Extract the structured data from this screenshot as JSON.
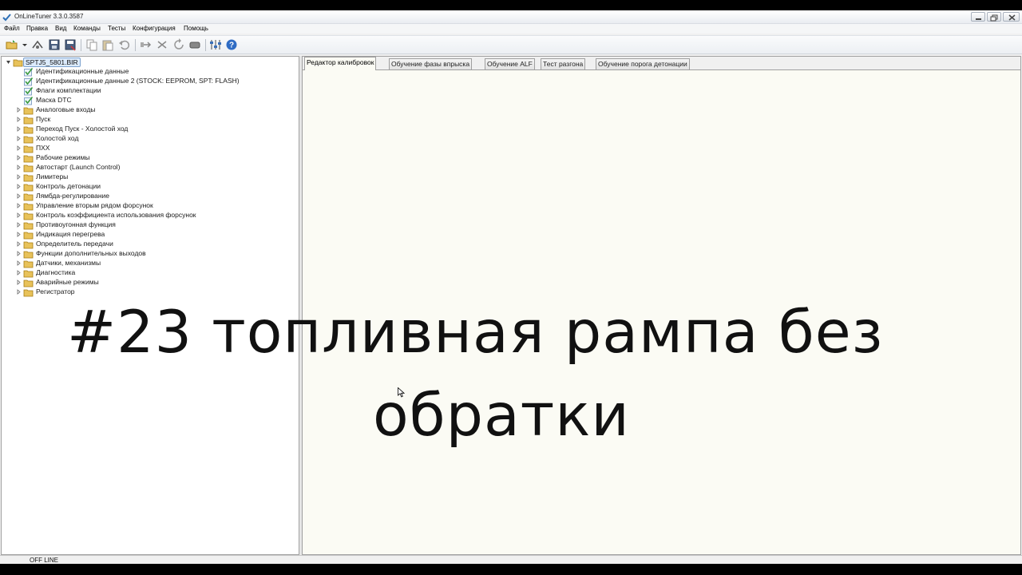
{
  "window": {
    "title": "OnLineTuner 3.3.0.3587"
  },
  "menu": {
    "items": [
      "Файл",
      "Правка",
      "Вид",
      "Команды",
      "Тесты",
      "Конфигурация",
      "Помощь"
    ]
  },
  "toolbar": {
    "buttons": [
      "open-icon",
      "dropdown-arrow-icon",
      "read-ecu-icon",
      "save-icon",
      "save-as-icon",
      "copy-icon",
      "paste-icon",
      "undo-icon",
      "connect-icon",
      "disconnect-icon",
      "refresh-icon",
      "ecu-icon",
      "settings-icon",
      "help-icon"
    ]
  },
  "tree": {
    "root": "SPTJ5_5801.BIR",
    "items": [
      {
        "label": "Идентификационные данные",
        "kind": "table"
      },
      {
        "label": "Идентификационные данные 2 (STOCK: EEPROM, SPT: FLASH)",
        "kind": "table"
      },
      {
        "label": "Флаги комплектации",
        "kind": "table"
      },
      {
        "label": "Маска DTC",
        "kind": "table"
      },
      {
        "label": "Аналоговые входы",
        "kind": "folder"
      },
      {
        "label": "Пуск",
        "kind": "folder"
      },
      {
        "label": "Переход Пуск - Холостой ход",
        "kind": "folder"
      },
      {
        "label": "Холостой ход",
        "kind": "folder"
      },
      {
        "label": "ПХХ",
        "kind": "folder"
      },
      {
        "label": "Рабочие режимы",
        "kind": "folder"
      },
      {
        "label": "Автостарт (Launch Control)",
        "kind": "folder"
      },
      {
        "label": "Лимитеры",
        "kind": "folder"
      },
      {
        "label": "Контроль детонации",
        "kind": "folder"
      },
      {
        "label": "Лямбда-регулирование",
        "kind": "folder"
      },
      {
        "label": "Управление вторым рядом форсунок",
        "kind": "folder"
      },
      {
        "label": "Контроль коэффициента использования форсунок",
        "kind": "folder"
      },
      {
        "label": "Противоугонная функция",
        "kind": "folder"
      },
      {
        "label": "Индикация перегрева",
        "kind": "folder"
      },
      {
        "label": "Определитель передачи",
        "kind": "folder"
      },
      {
        "label": "Функции дополнительных выходов",
        "kind": "folder"
      },
      {
        "label": "Датчики, механизмы",
        "kind": "folder"
      },
      {
        "label": "Диагностика",
        "kind": "folder"
      },
      {
        "label": "Аварийные режимы",
        "kind": "folder"
      },
      {
        "label": "Регистратор",
        "kind": "folder"
      }
    ]
  },
  "tabs": [
    {
      "label": "Редактор калибровок",
      "active": true
    },
    {
      "label": "Обучение фазы впрыска",
      "active": false
    },
    {
      "label": "Обучение ALF",
      "active": false
    },
    {
      "label": "Тест разгона",
      "active": false
    },
    {
      "label": "Обучение порога детонации",
      "active": false
    }
  ],
  "overlay": {
    "line1": "#23 топливная рампа без",
    "line2": "обратки"
  },
  "status": {
    "connection": "OFF LINE"
  },
  "colors": {
    "selection": "#dcebfc",
    "content_bg": "#fbfbf4",
    "folder": "#e8c25a",
    "check": "#3a9a3a"
  }
}
